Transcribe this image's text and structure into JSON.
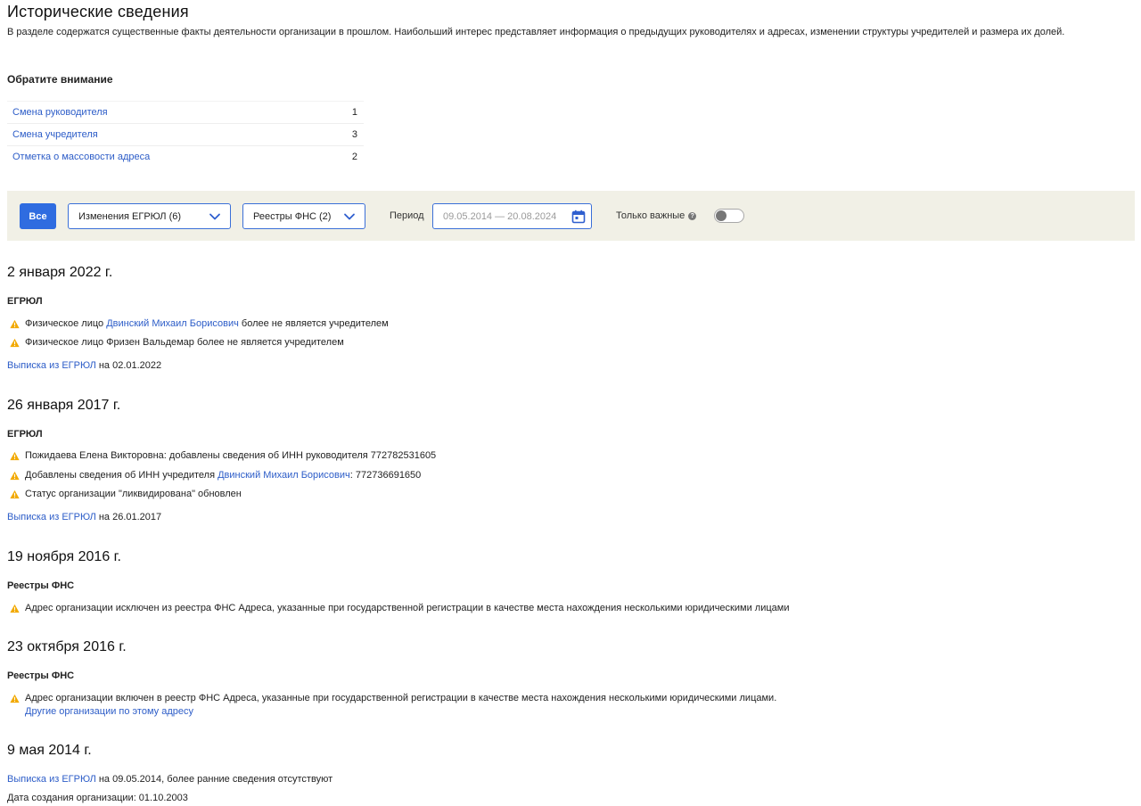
{
  "header": {
    "title": "Исторические сведения",
    "description": "В разделе содержатся существенные факты деятельности организации в прошлом. Наибольший интерес представляет информация о предыдущих руководителях и адресах, изменении структуры учредителей и размера их долей."
  },
  "notice": {
    "title": "Обратите внимание",
    "rows": [
      {
        "label": "Смена руководителя",
        "count": "1"
      },
      {
        "label": "Смена учредителя",
        "count": "3"
      },
      {
        "label": "Отметка о массовости адреса",
        "count": "2"
      }
    ]
  },
  "filters": {
    "all_label": "Все",
    "egrul_select": "Изменения ЕГРЮЛ (6)",
    "fns_select": "Реестры ФНС (2)",
    "period_label": "Период",
    "period_value": "09.05.2014 — 20.08.2024",
    "important_label": "Только важные",
    "info_glyph": "?",
    "important_toggle_on": false,
    "accent_color": "#2f6ce0",
    "bar_color": "#f1f0e6",
    "warning_color": "#f2a900",
    "link_color": "#2d5dc8",
    "icons": {
      "egrul_chevron": "chevron-down-icon",
      "fns_chevron": "chevron-down-icon",
      "period": "calendar-icon",
      "info": "info-icon",
      "event": "warning-icon"
    }
  },
  "timeline": {
    "g1": {
      "date": "2 января 2022 г.",
      "source": "ЕГРЮЛ",
      "e1_pre": "Физическое лицо ",
      "e1_link": "Двинский Михаил Борисович",
      "e1_post": " более не является учредителем",
      "e2": "Физическое лицо Фризен Вальдемар более не является учредителем",
      "extract_link": "Выписка из ЕГРЮЛ",
      "extract_date": " на 02.01.2022"
    },
    "g2": {
      "date": "26 января 2017 г.",
      "source": "ЕГРЮЛ",
      "e1": "Пожидаева Елена Викторовна: добавлены сведения об ИНН руководителя 772782531605",
      "e2_pre": "Добавлены сведения об ИНН учредителя ",
      "e2_link": "Двинский Михаил Борисович",
      "e2_post": ": 772736691650",
      "e3": "Статус организации \"ликвидирована\" обновлен",
      "extract_link": "Выписка из ЕГРЮЛ",
      "extract_date": " на 26.01.2017"
    },
    "g3": {
      "date": "19 ноября 2016 г.",
      "source": "Реестры ФНС",
      "e1": "Адрес организации исключен из реестра ФНС Адреса, указанные при государственной регистрации в качестве места нахождения несколькими юридическими лицами"
    },
    "g4": {
      "date": "23 октября 2016 г.",
      "source": "Реестры ФНС",
      "e1": "Адрес организации включен в реестр ФНС Адреса, указанные при государственной регистрации в качестве места нахождения несколькими юридическими лицами.",
      "other_orgs_link": "Другие организации по этому адресу"
    },
    "g5": {
      "date": "9 мая 2014 г.",
      "extract_link": "Выписка из ЕГРЮЛ",
      "extract_note": " на 09.05.2014, более ранние сведения отсутствуют",
      "creation_date": "Дата создания организации: 01.10.2003"
    }
  }
}
